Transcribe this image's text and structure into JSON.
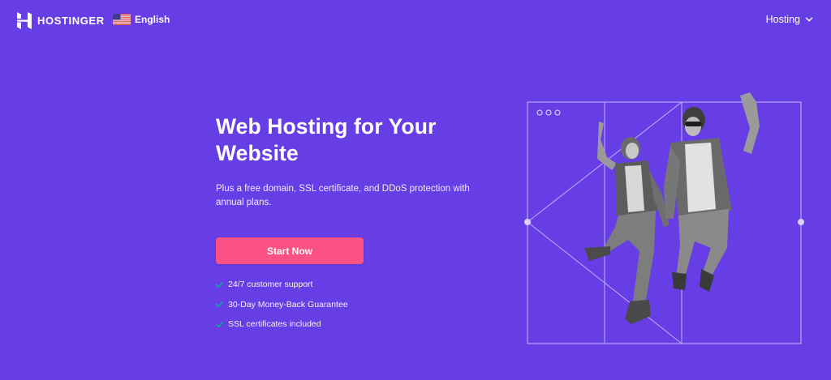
{
  "header": {
    "brand": "HOSTINGER",
    "language": "English",
    "nav_item": "Hosting"
  },
  "hero": {
    "title": "Web Hosting for Your Website",
    "subtitle": "Plus a free domain, SSL certificate, and DDoS protection with annual plans.",
    "cta_label": "Start Now",
    "features": [
      "24/7 customer support",
      "30-Day Money-Back Guarantee",
      "SSL certificates included"
    ]
  },
  "icons": {
    "logo": "hostinger-logo-icon",
    "flag": "us-flag-icon",
    "chevron": "chevron-down-icon",
    "check": "check-icon"
  },
  "colors": {
    "background": "#673de6",
    "cta": "#fc5185",
    "check": "#00b090",
    "frame_lines": "#b9a7f5"
  }
}
